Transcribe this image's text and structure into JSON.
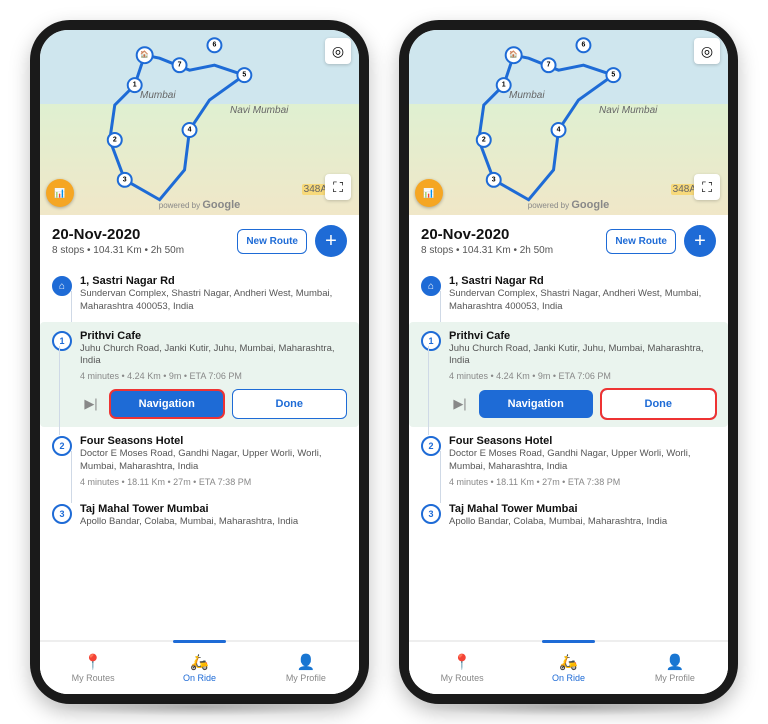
{
  "map": {
    "city1": "Mumbai",
    "city2": "Navi Mumbai",
    "brand_small": "powered by",
    "brand": "Google",
    "road_label": "348A"
  },
  "header": {
    "date": "20-Nov-2020",
    "summary": "8 stops  • 104.31 Km  • 2h 50m",
    "new_route": "New Route"
  },
  "stops": [
    {
      "num": "home",
      "title": "1, Sastri Nagar Rd",
      "addr": "Sundervan Complex, Shastri Nagar, Andheri West, Mumbai, Maharashtra 400053, India"
    },
    {
      "num": "1",
      "title": "Prithvi Cafe",
      "addr": "Juhu Church Road, Janki Kutir, Juhu, Mumbai, Maharashtra, India",
      "meta": "4 minutes  • 4.24 Km  • 9m  • ETA 7:06 PM",
      "actions": {
        "nav": "Navigation",
        "done": "Done"
      }
    },
    {
      "num": "2",
      "title": "Four Seasons Hotel",
      "addr": "Doctor E Moses Road, Gandhi Nagar, Upper Worli, Worli, Mumbai, Maharashtra, India",
      "meta": "4 minutes  • 18.11 Km  • 27m  • ETA 7:38 PM"
    },
    {
      "num": "3",
      "title": "Taj Mahal Tower Mumbai",
      "addr": "Apollo Bandar, Colaba, Mumbai, Maharashtra, India"
    }
  ],
  "nav": {
    "routes": "My Routes",
    "onride": "On Ride",
    "profile": "My Profile"
  }
}
